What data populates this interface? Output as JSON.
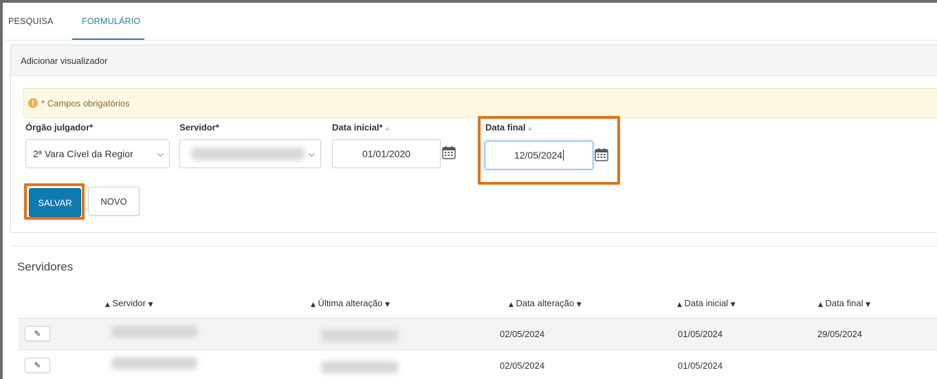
{
  "tabs": [
    {
      "label": "PESQUISA"
    },
    {
      "label": "FORMULÁRIO",
      "active": true
    }
  ],
  "panel": {
    "title": "Adicionar visualizador"
  },
  "alert": {
    "icon": "warning-icon",
    "text": "* Campos obrigatórios"
  },
  "form": {
    "orgao_label": "Órgão julgador*",
    "orgao_value": "2ª Vara Cível da Regior",
    "servidor_label": "Servidor*",
    "data_inicial_label": "Data inicial*",
    "data_inicial_value": "01/01/2020",
    "data_final_label": "Data final",
    "data_final_value": "12/05/2024"
  },
  "buttons": {
    "save": "SALVAR",
    "new": "NOVO"
  },
  "table": {
    "title": "Servidores",
    "columns": [
      "Servidor",
      "Última alteração",
      "Data alteração",
      "Data inicial",
      "Data final"
    ],
    "rows": [
      {
        "data_alteracao": "02/05/2024",
        "data_inicial": "01/05/2024",
        "data_final": "29/05/2024"
      },
      {
        "data_alteracao": "02/05/2024",
        "data_inicial": "01/05/2024",
        "data_final": ""
      }
    ]
  },
  "colors": {
    "accent": "#0f7ab0",
    "highlight": "#e0721b",
    "tab_active": "#2a7fa5",
    "alert_bg": "#fcf8e3"
  }
}
